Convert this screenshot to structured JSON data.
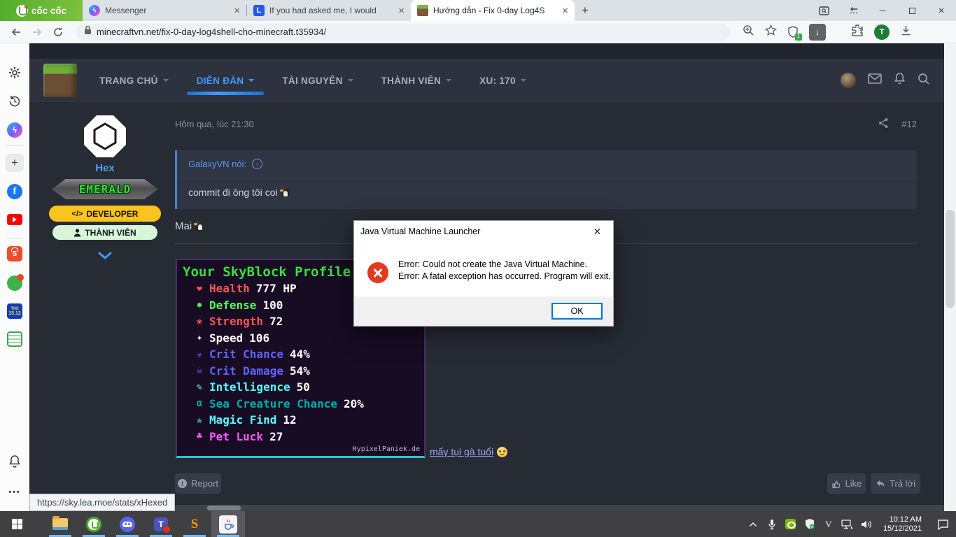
{
  "browser": {
    "brand": "cốc cốc",
    "tabs": [
      {
        "title": "Messenger",
        "icon": "messenger-icon",
        "active": false
      },
      {
        "title": "If you had asked me, I would",
        "icon": "l-icon",
        "active": false
      },
      {
        "title": "Hướng dẫn - Fix 0-day Log4S",
        "icon": "minecraft-icon",
        "active": true
      }
    ],
    "new_tab": "+",
    "url": "minecraftvn.net/fix-0-day-log4shell-cho-minecraft.t35934/",
    "shield_badge": "1",
    "profile_initial": "T",
    "status_link": "https://sky.lea.moe/stats/xHexed"
  },
  "sidebar": {
    "icons": [
      "settings",
      "history",
      "messenger",
      "add",
      "facebook",
      "youtube",
      "shopee",
      "sale",
      "tiki",
      "news",
      "notifications",
      "more"
    ],
    "tiki_top": "TIKI",
    "tiki_bottom": "15.12",
    "more_label": "•••"
  },
  "forum_nav": {
    "items": [
      {
        "label": "TRANG CHỦ",
        "active": false
      },
      {
        "label": "DIỄN ĐÀN",
        "active": true
      },
      {
        "label": "TÀI NGUYÊN",
        "active": false
      },
      {
        "label": "THÀNH VIÊN",
        "active": false
      },
      {
        "label": "XU: 170",
        "active": false
      }
    ],
    "active_color": "#3d9bff"
  },
  "post": {
    "timestamp": "Hôm qua, lúc 21:30",
    "number": "#12",
    "author": "Hex",
    "rank": "EMERALD",
    "badge_developer_icon": "</>",
    "badge_developer": "DEVELOPER",
    "badge_member": "THÀNH VIÊN",
    "quote_header": "GalaxyVN nói:",
    "quote_body": "commit đi ông tôi coi",
    "quote_emoji": "penguin",
    "reply_text": "Mai",
    "reply_emoji": "penguin",
    "link_text": "mấy tụi gà tuổi",
    "link_emoji": "smirk-face",
    "report_label": "Report",
    "like_label": "Like",
    "reply_label": "Trả lời"
  },
  "skyblock": {
    "title": "Your SkyBlock Profile",
    "watermark": "HypixelPaniek.de",
    "title_color": "#3ae03a",
    "stats": [
      {
        "icon": "❤",
        "label": "Health",
        "value": "777 HP",
        "color": "#FF5555"
      },
      {
        "icon": "✸",
        "label": "Defense",
        "value": "100",
        "color": "#55FF55"
      },
      {
        "icon": "❀",
        "label": "Strength",
        "value": "72",
        "color": "#FF5555"
      },
      {
        "icon": "✦",
        "label": "Speed",
        "value": "106",
        "color": "#FFFFFF"
      },
      {
        "icon": "☣",
        "label": "Crit Chance",
        "value": "44%",
        "color": "#6262FF"
      },
      {
        "icon": "☠",
        "label": "Crit Damage",
        "value": "54%",
        "color": "#6262FF"
      },
      {
        "icon": "✎",
        "label": "Intelligence",
        "value": "50",
        "color": "#55FFFF"
      },
      {
        "icon": "α",
        "label": "Sea Creature Chance",
        "value": "20%",
        "color": "#00AAAA"
      },
      {
        "icon": "✯",
        "label": "Magic Find",
        "value": "12",
        "color": "#55FFFF"
      },
      {
        "icon": "♣",
        "label": "Pet Luck",
        "value": "27",
        "color": "#FF55FF"
      }
    ]
  },
  "dialog": {
    "title": "Java Virtual Machine Launcher",
    "line1": "Error: Could not create the Java Virtual Machine.",
    "line2": "Error: A fatal exception has occurred. Program will exit.",
    "ok_label": "OK"
  },
  "taskbar": {
    "time": "10:12 AM",
    "date": "15/12/2021",
    "apps": [
      "start",
      "file-explorer",
      "coccoc",
      "discord",
      "teams",
      "sublime",
      "java"
    ]
  }
}
